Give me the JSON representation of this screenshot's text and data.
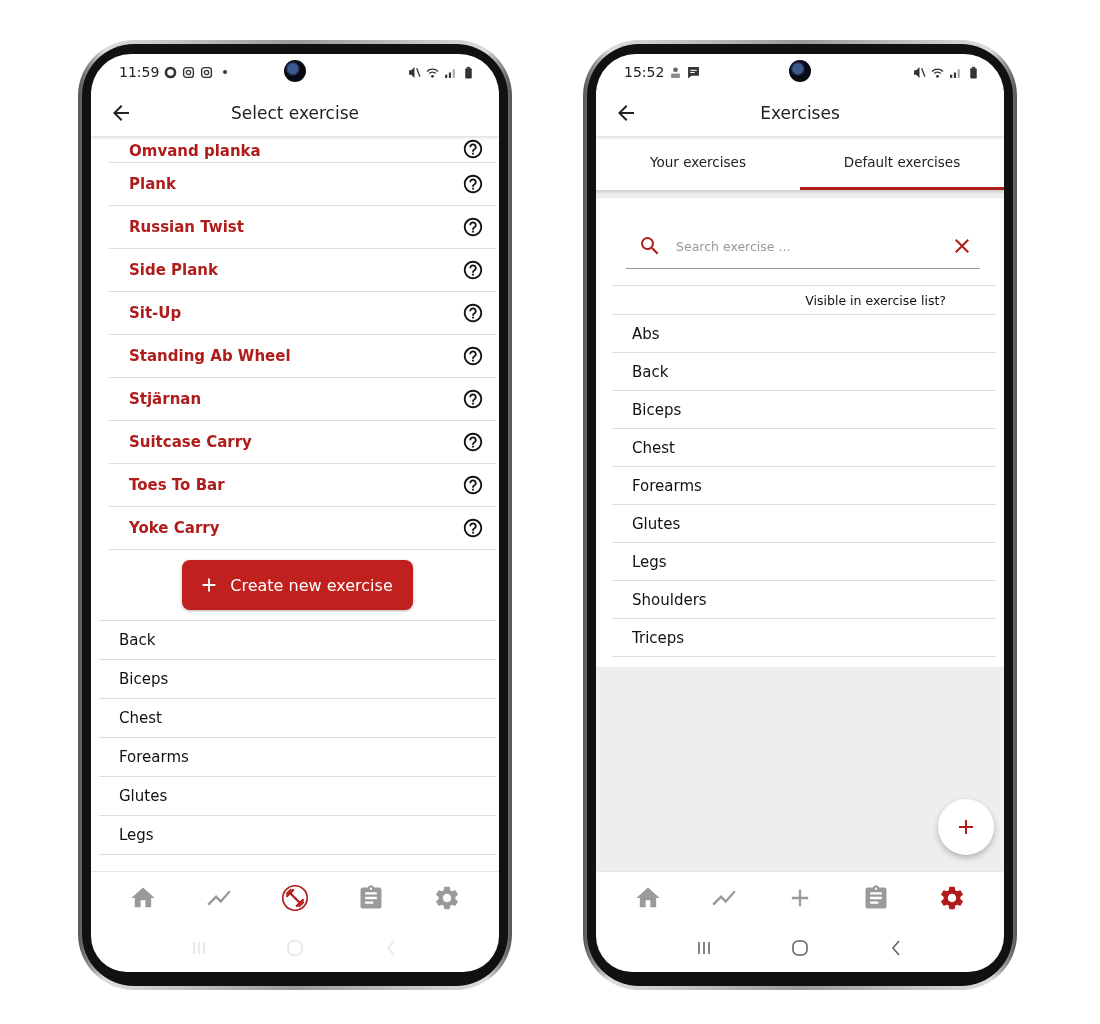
{
  "phones": [
    {
      "kind": "select",
      "status_bar": {
        "time": "11:59"
      },
      "header": {
        "title": "Select exercise"
      },
      "exercises": [
        {
          "name": "Omvand planka"
        },
        {
          "name": "Plank"
        },
        {
          "name": "Russian Twist"
        },
        {
          "name": "Side Plank"
        },
        {
          "name": "Sit-Up"
        },
        {
          "name": "Standing Ab Wheel"
        },
        {
          "name": "Stjärnan"
        },
        {
          "name": "Suitcase Carry"
        },
        {
          "name": "Toes To Bar"
        },
        {
          "name": "Yoke Carry"
        }
      ],
      "create_button": {
        "label": "Create new exercise"
      },
      "categories": [
        {
          "name": "Back"
        },
        {
          "name": "Biceps"
        },
        {
          "name": "Chest"
        },
        {
          "name": "Forearms"
        },
        {
          "name": "Glutes"
        },
        {
          "name": "Legs"
        }
      ],
      "nav": [
        {
          "kind": "home",
          "selected": false
        },
        {
          "kind": "trend",
          "selected": false
        },
        {
          "kind": "dumbbell",
          "selected": true
        },
        {
          "kind": "clipboard",
          "selected": false
        },
        {
          "kind": "gear",
          "selected": false
        }
      ]
    },
    {
      "kind": "manage",
      "status_bar": {
        "time": "15:52"
      },
      "header": {
        "title": "Exercises"
      },
      "tabs": [
        {
          "label": "Your exercises",
          "selected": false
        },
        {
          "label": "Default exercises",
          "selected": true
        }
      ],
      "search": {
        "placeholder": "Search exercise ..."
      },
      "list_header": "Visible in exercise list?",
      "categories": [
        {
          "name": "Abs"
        },
        {
          "name": "Back"
        },
        {
          "name": "Biceps"
        },
        {
          "name": "Chest"
        },
        {
          "name": "Forearms"
        },
        {
          "name": "Glutes"
        },
        {
          "name": "Legs"
        },
        {
          "name": "Shoulders"
        },
        {
          "name": "Triceps"
        }
      ],
      "nav": [
        {
          "kind": "home",
          "selected": false
        },
        {
          "kind": "trend",
          "selected": false
        },
        {
          "kind": "add",
          "selected": false
        },
        {
          "kind": "clipboard",
          "selected": false
        },
        {
          "kind": "gear",
          "selected": true
        }
      ]
    }
  ]
}
